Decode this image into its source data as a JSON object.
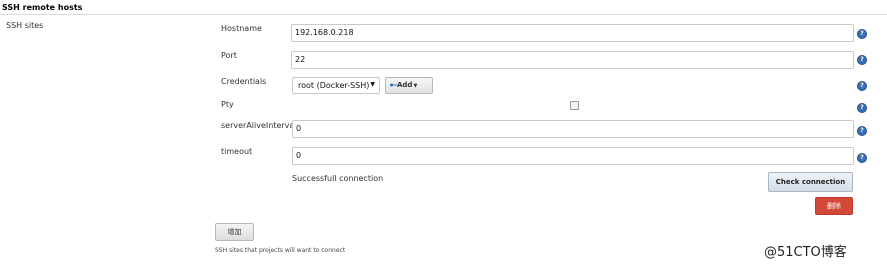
{
  "section": {
    "title": "SSH remote hosts"
  },
  "sites_label": "SSH sites",
  "fields": {
    "hostname": {
      "label": "Hostname",
      "value": "192.168.0.218"
    },
    "port": {
      "label": "Port",
      "value": "22"
    },
    "credentials": {
      "label": "Credentials",
      "selected": "root (Docker-SSH)",
      "add_label": "Add"
    },
    "pty": {
      "label": "Pty",
      "checked": false
    },
    "server_alive_interval": {
      "label": "serverAliveInterval",
      "value": "0"
    },
    "timeout": {
      "label": "timeout",
      "value": "0"
    }
  },
  "help_glyph": "?",
  "status": {
    "text": "Successfull connection"
  },
  "buttons": {
    "check_connection": "Check connection",
    "delete": "删除",
    "add_site": "增加"
  },
  "footer": {
    "description": "SSH sites that projects will want to connect"
  },
  "watermark": "@51CTO博客",
  "colors": {
    "help_icon": "#3a6fb3",
    "delete_button": "#d24939"
  },
  "icons": {
    "help": "help-icon",
    "key": "key-icon",
    "caret": "chevron-down-icon"
  }
}
